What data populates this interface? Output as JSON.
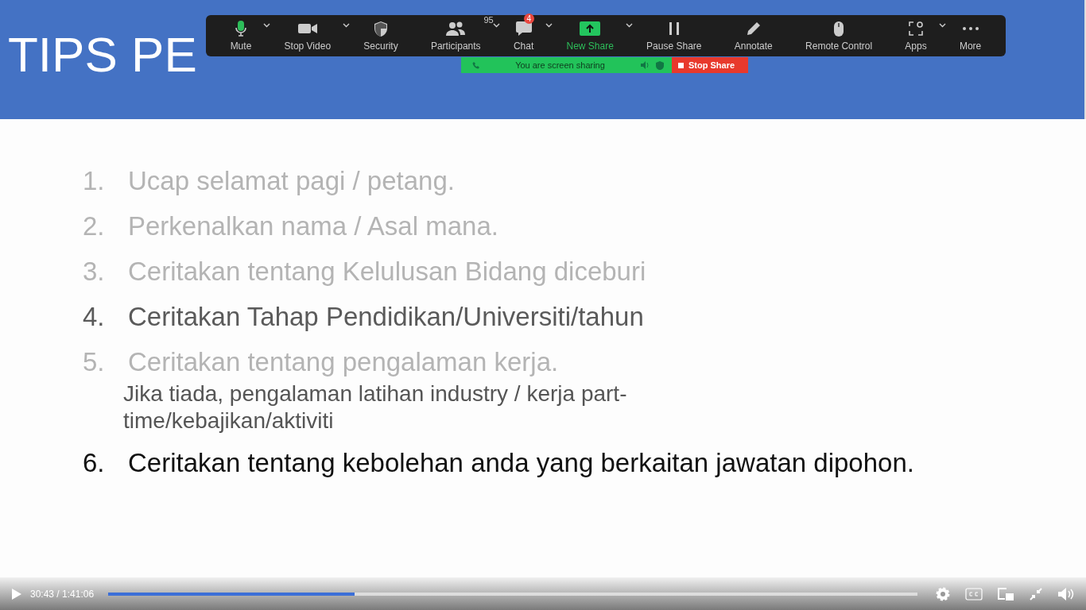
{
  "slide": {
    "title": "TIPS PE",
    "items": [
      {
        "number": "1.",
        "text": "Ucap selamat pagi / petang.",
        "kind": "faded"
      },
      {
        "number": "2.",
        "text": "Perkenalkan nama / Asal mana.",
        "kind": "faded"
      },
      {
        "number": "3.",
        "text": "Ceritakan tentang Kelulusan Bidang diceburi",
        "kind": "faded"
      },
      {
        "number": "4.",
        "text": "Ceritakan Tahap Pendidikan/Universiti/tahun",
        "kind": "medium"
      },
      {
        "number": "5.",
        "text": "Ceritakan tentang pengalaman kerja.",
        "kind": "faded",
        "note": "Jika tiada, pengalaman latihan industry / kerja part-time/kebajikan/aktiviti"
      },
      {
        "number": "6.",
        "text": "Ceritakan tentang kebolehan anda yang berkaitan jawatan dipohon.",
        "kind": "strong"
      }
    ]
  },
  "meeting_toolbar": {
    "buttons": [
      {
        "label": "Mute",
        "kind": "mic",
        "caret": true
      },
      {
        "label": "Stop Video",
        "kind": "camera",
        "caret": true
      },
      {
        "label": "Security",
        "kind": "shield",
        "caret": false
      },
      {
        "label": "Participants",
        "kind": "people",
        "caret": true,
        "count": "95"
      },
      {
        "label": "Chat",
        "kind": "chat",
        "caret": true,
        "badge": "4"
      },
      {
        "label": "New Share",
        "kind": "share",
        "caret": true
      },
      {
        "label": "Pause Share",
        "kind": "pause",
        "caret": false
      },
      {
        "label": "Annotate",
        "kind": "pencil",
        "caret": false
      },
      {
        "label": "Remote Control",
        "kind": "mouse",
        "caret": false
      },
      {
        "label": "Apps",
        "kind": "apps",
        "caret": true
      },
      {
        "label": "More",
        "kind": "dots",
        "caret": false
      }
    ],
    "sharing_banner": "You are screen sharing",
    "stop_share": "Stop Share"
  },
  "player": {
    "time": "30:43 / 1:41:06",
    "level": 0.304
  }
}
